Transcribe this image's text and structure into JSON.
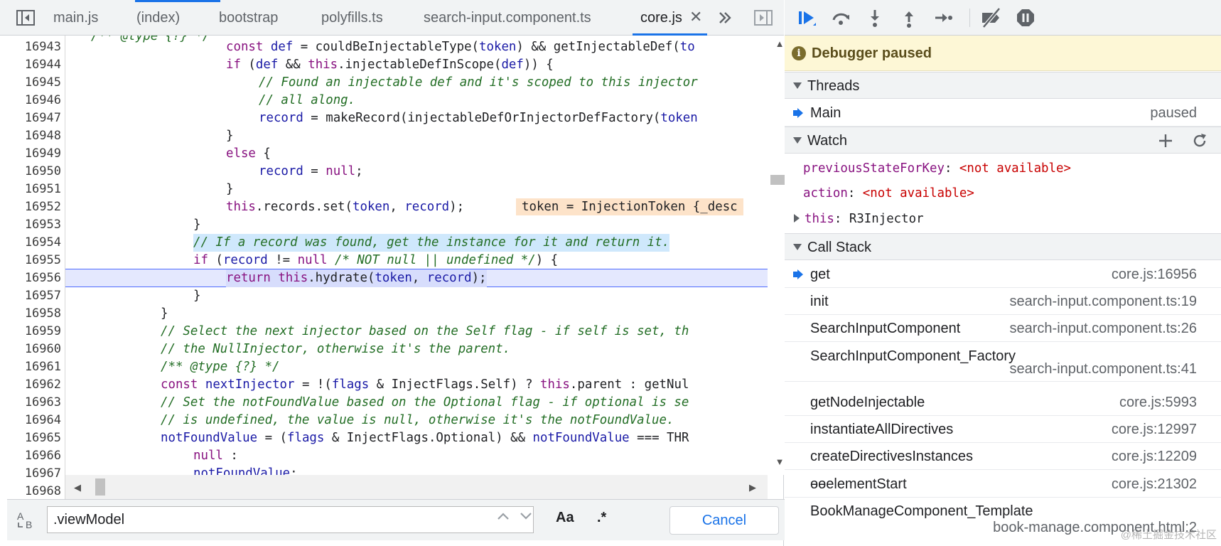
{
  "tabs": [
    {
      "label": "main.js"
    },
    {
      "label": "(index)"
    },
    {
      "label": "bootstrap"
    },
    {
      "label": "polyfills.ts"
    },
    {
      "label": "search-input.component.ts"
    },
    {
      "label": "core.js"
    }
  ],
  "tab_overflow_icon": "double-chevron-right-icon",
  "active_tab": "core.js",
  "code": {
    "first_line": 16943,
    "current_line": 16956,
    "highlighted_comment_line": 16954,
    "line_numbers": [
      "16943",
      "16944",
      "16945",
      "16946",
      "16947",
      "16948",
      "16949",
      "16950",
      "16951",
      "16952",
      "16953",
      "16954",
      "16955",
      "16956",
      "16957",
      "16958",
      "16959",
      "16960",
      "16961",
      "16962",
      "16963",
      "16964",
      "16965",
      "16966",
      "16967",
      "16968"
    ],
    "inline_value": "token = InjectionToken {_desc"
  },
  "search": {
    "value": ".viewModel",
    "match_case_label": "Aa",
    "regex_label": ".*",
    "cancel_label": "Cancel"
  },
  "debugger": {
    "paused_label": "Debugger paused",
    "threads_label": "Threads",
    "thread": {
      "name": "Main",
      "status": "paused"
    },
    "watch_label": "Watch",
    "watch_items": [
      {
        "name": "previousStateForKey",
        "value": "<not available>"
      },
      {
        "name": "action",
        "value": "<not available>"
      },
      {
        "name": "this",
        "value": "R3Injector"
      }
    ],
    "call_stack_label": "Call Stack",
    "frames": [
      {
        "name": "get",
        "location": "core.js:16956"
      },
      {
        "name": "init",
        "location": "search-input.component.ts:19"
      },
      {
        "name": "SearchInputComponent",
        "location": "search-input.component.ts:26"
      },
      {
        "name": "SearchInputComponent_Factory",
        "location": "search-input.component.ts:41"
      },
      {
        "name": "getNodeInjectable",
        "location": "core.js:5993"
      },
      {
        "name": "instantiateAllDirectives",
        "location": "core.js:12997"
      },
      {
        "name": "createDirectivesInstances",
        "location": "core.js:12209"
      },
      {
        "name": "ɵɵelementStart",
        "location": "core.js:21302"
      },
      {
        "name": "BookManageComponent_Template",
        "location": "book-manage.component.html:2"
      }
    ]
  },
  "colors": {
    "accent": "#1a73e8",
    "paused_banner": "#fdf7d6",
    "exec_line": "#e4e8fe",
    "comment_highlight": "#cfe8fc",
    "inline_value_bg": "#fde3c9"
  },
  "watermark": "@稀土掘金技术社区"
}
